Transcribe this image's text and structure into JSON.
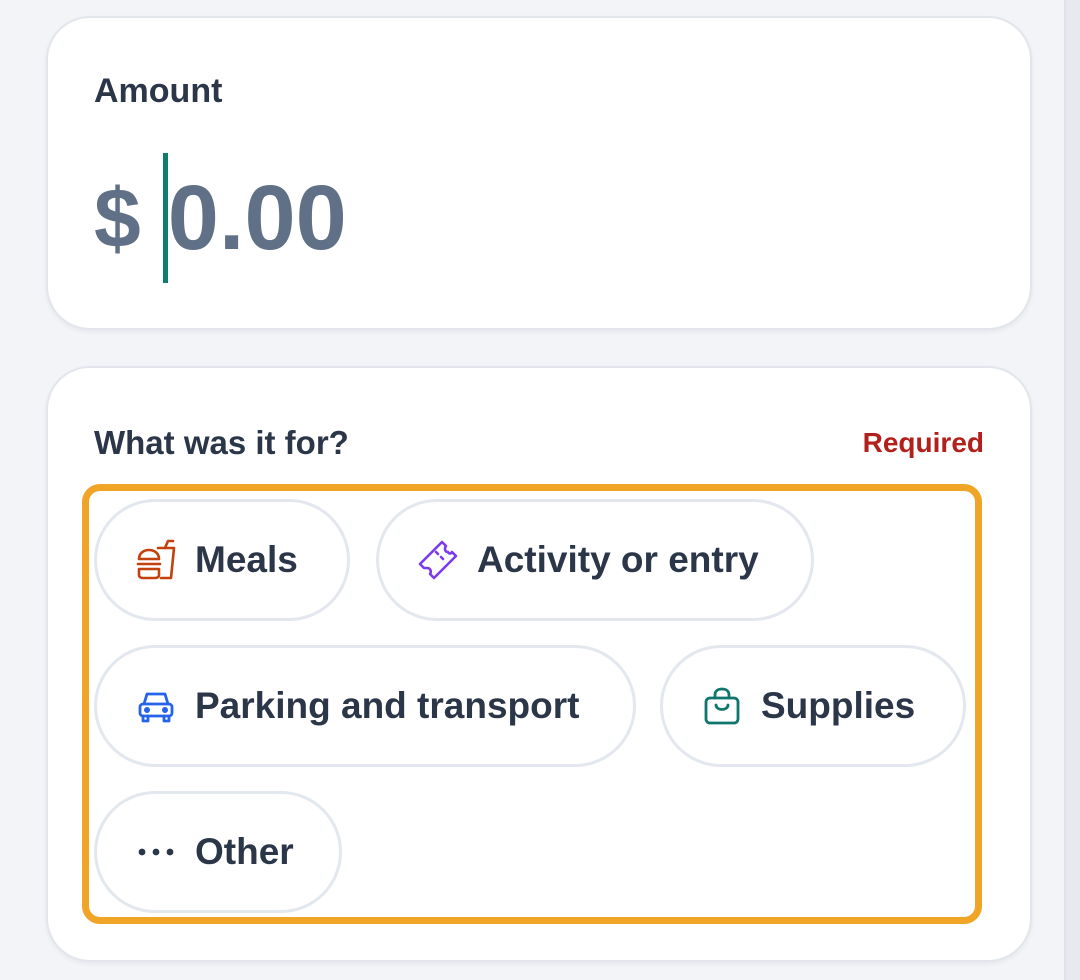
{
  "amount": {
    "label": "Amount",
    "currency_symbol": "$",
    "placeholder": "0.00",
    "value": ""
  },
  "category": {
    "title": "What was it for?",
    "required_label": "Required",
    "options": [
      {
        "label": "Meals",
        "icon": "meals-icon",
        "color": "#c2410c"
      },
      {
        "label": "Activity or entry",
        "icon": "ticket-icon",
        "color": "#7c3aed"
      },
      {
        "label": "Parking and transport",
        "icon": "car-icon",
        "color": "#2563eb"
      },
      {
        "label": "Supplies",
        "icon": "shopping-bag-icon",
        "color": "#0f766e"
      },
      {
        "label": "Other",
        "icon": "more-icon",
        "color": "#2b3648"
      }
    ]
  },
  "colors": {
    "accent_caret": "#0f7c6c",
    "focus_ring": "#f1a526",
    "required": "#b3201c",
    "text": "#2b3648",
    "amount_text": "#5f7087"
  }
}
